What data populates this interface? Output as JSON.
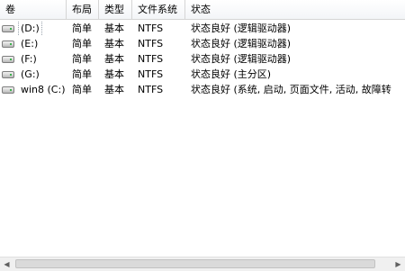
{
  "columns": [
    {
      "label": "卷"
    },
    {
      "label": "布局"
    },
    {
      "label": "类型"
    },
    {
      "label": "文件系统"
    },
    {
      "label": "状态"
    }
  ],
  "rows": [
    {
      "volume": "(D:)",
      "layout": "简单",
      "type": "基本",
      "fs": "NTFS",
      "status": "状态良好 (逻辑驱动器)"
    },
    {
      "volume": "(E:)",
      "layout": "简单",
      "type": "基本",
      "fs": "NTFS",
      "status": "状态良好 (逻辑驱动器)"
    },
    {
      "volume": "(F:)",
      "layout": "简单",
      "type": "基本",
      "fs": "NTFS",
      "status": "状态良好 (逻辑驱动器)"
    },
    {
      "volume": "(G:)",
      "layout": "简单",
      "type": "基本",
      "fs": "NTFS",
      "status": "状态良好 (主分区)"
    },
    {
      "volume": "win8 (C:)",
      "layout": "简单",
      "type": "基本",
      "fs": "NTFS",
      "status": "状态良好 (系统, 启动, 页面文件, 活动, 故障转"
    }
  ],
  "icons": {
    "volume_icon": "drive-icon",
    "scroll_left": "arrow-left-icon",
    "scroll_right": "arrow-right-icon"
  },
  "colors": {
    "header_bg": "#f3f5f8",
    "grid_line": "#d5d5d5",
    "scrollbar_bg": "#f0f0f0"
  }
}
